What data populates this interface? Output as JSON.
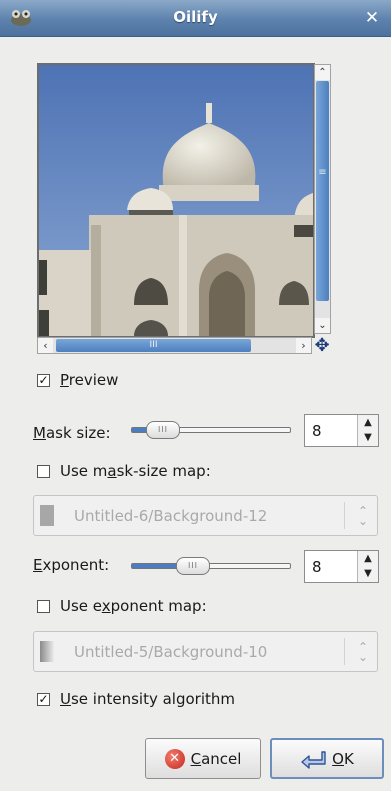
{
  "window": {
    "title": "Oilify"
  },
  "preview_toggle": {
    "label_pre": "",
    "label_mn": "P",
    "label_post": "review",
    "checked": true
  },
  "mask_size": {
    "label_mn": "M",
    "label_post": "ask size:",
    "value": "8",
    "level": 0.28
  },
  "mask_size_map": {
    "label_pre": "Use m",
    "label_mn": "a",
    "label_post": "sk-size map:",
    "checked": false
  },
  "mask_map_combo": {
    "text": "Untitled-6/Background-12",
    "swatch_color": "#a7a7a7"
  },
  "exponent": {
    "label_mn": "E",
    "label_post": "xponent:",
    "value": "8",
    "level": 0.28
  },
  "exponent_map": {
    "label_pre": "Use e",
    "label_mn": "x",
    "label_post": "ponent map:",
    "checked": false
  },
  "exponent_map_combo": {
    "text": "Untitled-5/Background-10"
  },
  "intensity": {
    "label_pre": "",
    "label_mn": "U",
    "label_post": "se intensity algorithm",
    "checked": true
  },
  "buttons": {
    "cancel": {
      "mn": "C",
      "rest": "ancel"
    },
    "ok": {
      "mn": "O",
      "rest": "K"
    }
  },
  "colors": {
    "accent": "#4b7ec0",
    "titlebar": "#5d82ad"
  }
}
